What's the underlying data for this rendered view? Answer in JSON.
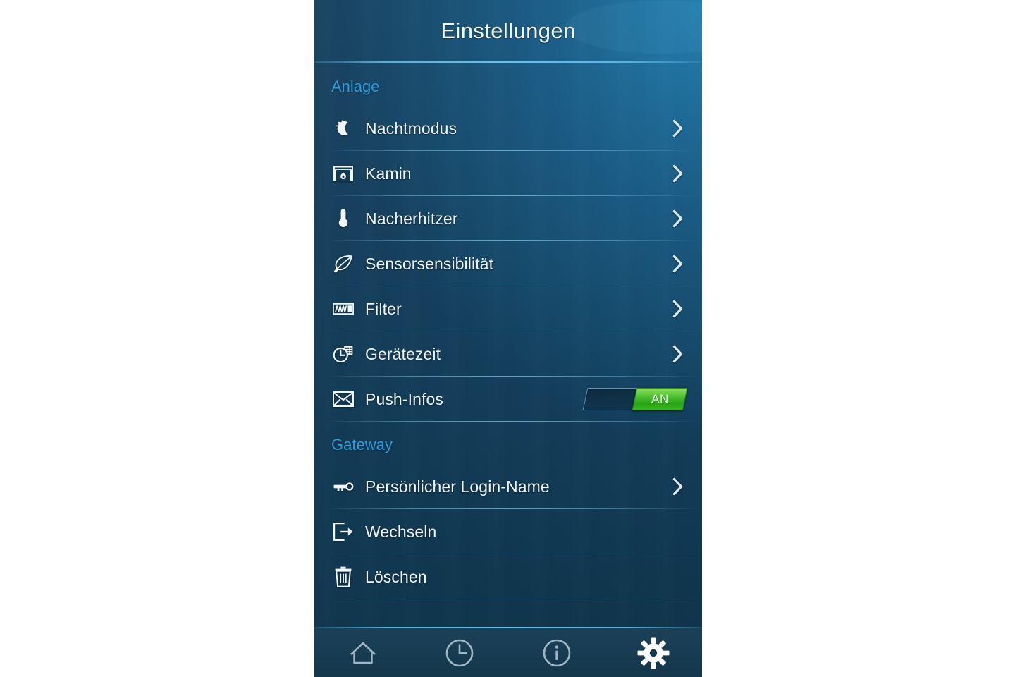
{
  "header": {
    "title": "Einstellungen"
  },
  "sections": [
    {
      "label": "Anlage",
      "items": [
        {
          "icon": "moon-icon",
          "label": "Nachtmodus",
          "control": "chevron"
        },
        {
          "icon": "fireplace-icon",
          "label": "Kamin",
          "control": "chevron"
        },
        {
          "icon": "thermometer-icon",
          "label": "Nacherhitzer",
          "control": "chevron"
        },
        {
          "icon": "leaf-icon",
          "label": "Sensorsensibilität",
          "control": "chevron"
        },
        {
          "icon": "filter-icon",
          "label": "Filter",
          "control": "chevron"
        },
        {
          "icon": "clock-calendar-icon",
          "label": "Gerätezeit",
          "control": "chevron"
        },
        {
          "icon": "envelope-icon",
          "label": "Push-Infos",
          "control": "toggle"
        }
      ]
    },
    {
      "label": "Gateway",
      "items": [
        {
          "icon": "key-icon",
          "label": "Persönlicher Login-Name",
          "control": "chevron"
        },
        {
          "icon": "logout-icon",
          "label": "Wechseln",
          "control": "none"
        },
        {
          "icon": "trash-icon",
          "label": "Löschen",
          "control": "none"
        }
      ]
    }
  ],
  "push_toggle": {
    "state_label": "AN",
    "on": true
  },
  "navbar": {
    "items": [
      {
        "icon": "home-icon",
        "name": "nav-home",
        "active": false
      },
      {
        "icon": "clock-icon",
        "name": "nav-history",
        "active": false
      },
      {
        "icon": "info-icon",
        "name": "nav-info",
        "active": false
      },
      {
        "icon": "gear-icon",
        "name": "nav-settings",
        "active": true
      }
    ]
  },
  "colors": {
    "accent_cyan": "#2e9ddd",
    "divider": "#60c4ee",
    "toggle_on_green": "#39b823",
    "text_primary": "#eef4f8",
    "bg_dark": "#0f3349",
    "bg_light": "#2482b4"
  }
}
